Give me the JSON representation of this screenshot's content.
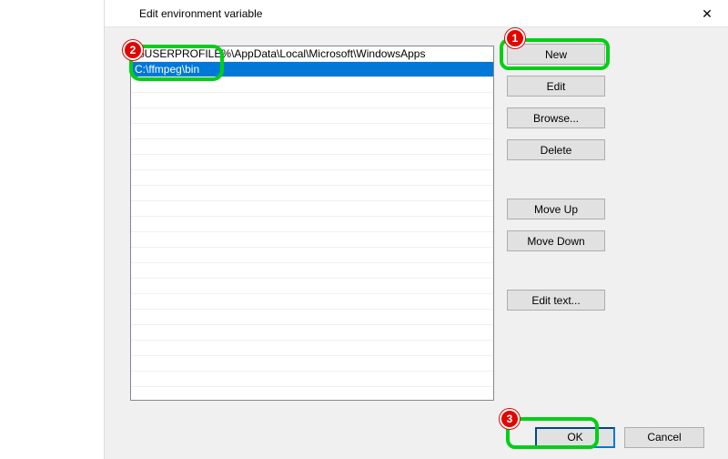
{
  "window": {
    "title": "Edit environment variable",
    "close_glyph": "✕"
  },
  "list_entries": {
    "0": "%USERPROFILE%\\AppData\\Local\\Microsoft\\WindowsApps",
    "1": "C:\\ffmpeg\\bin"
  },
  "buttons": {
    "new": "New",
    "edit": "Edit",
    "browse": "Browse...",
    "delete": "Delete",
    "move_up": "Move Up",
    "move_down": "Move Down",
    "edit_text": "Edit text...",
    "ok": "OK",
    "cancel": "Cancel"
  },
  "annotations": {
    "badge1": "1",
    "badge2": "2",
    "badge3": "3"
  }
}
